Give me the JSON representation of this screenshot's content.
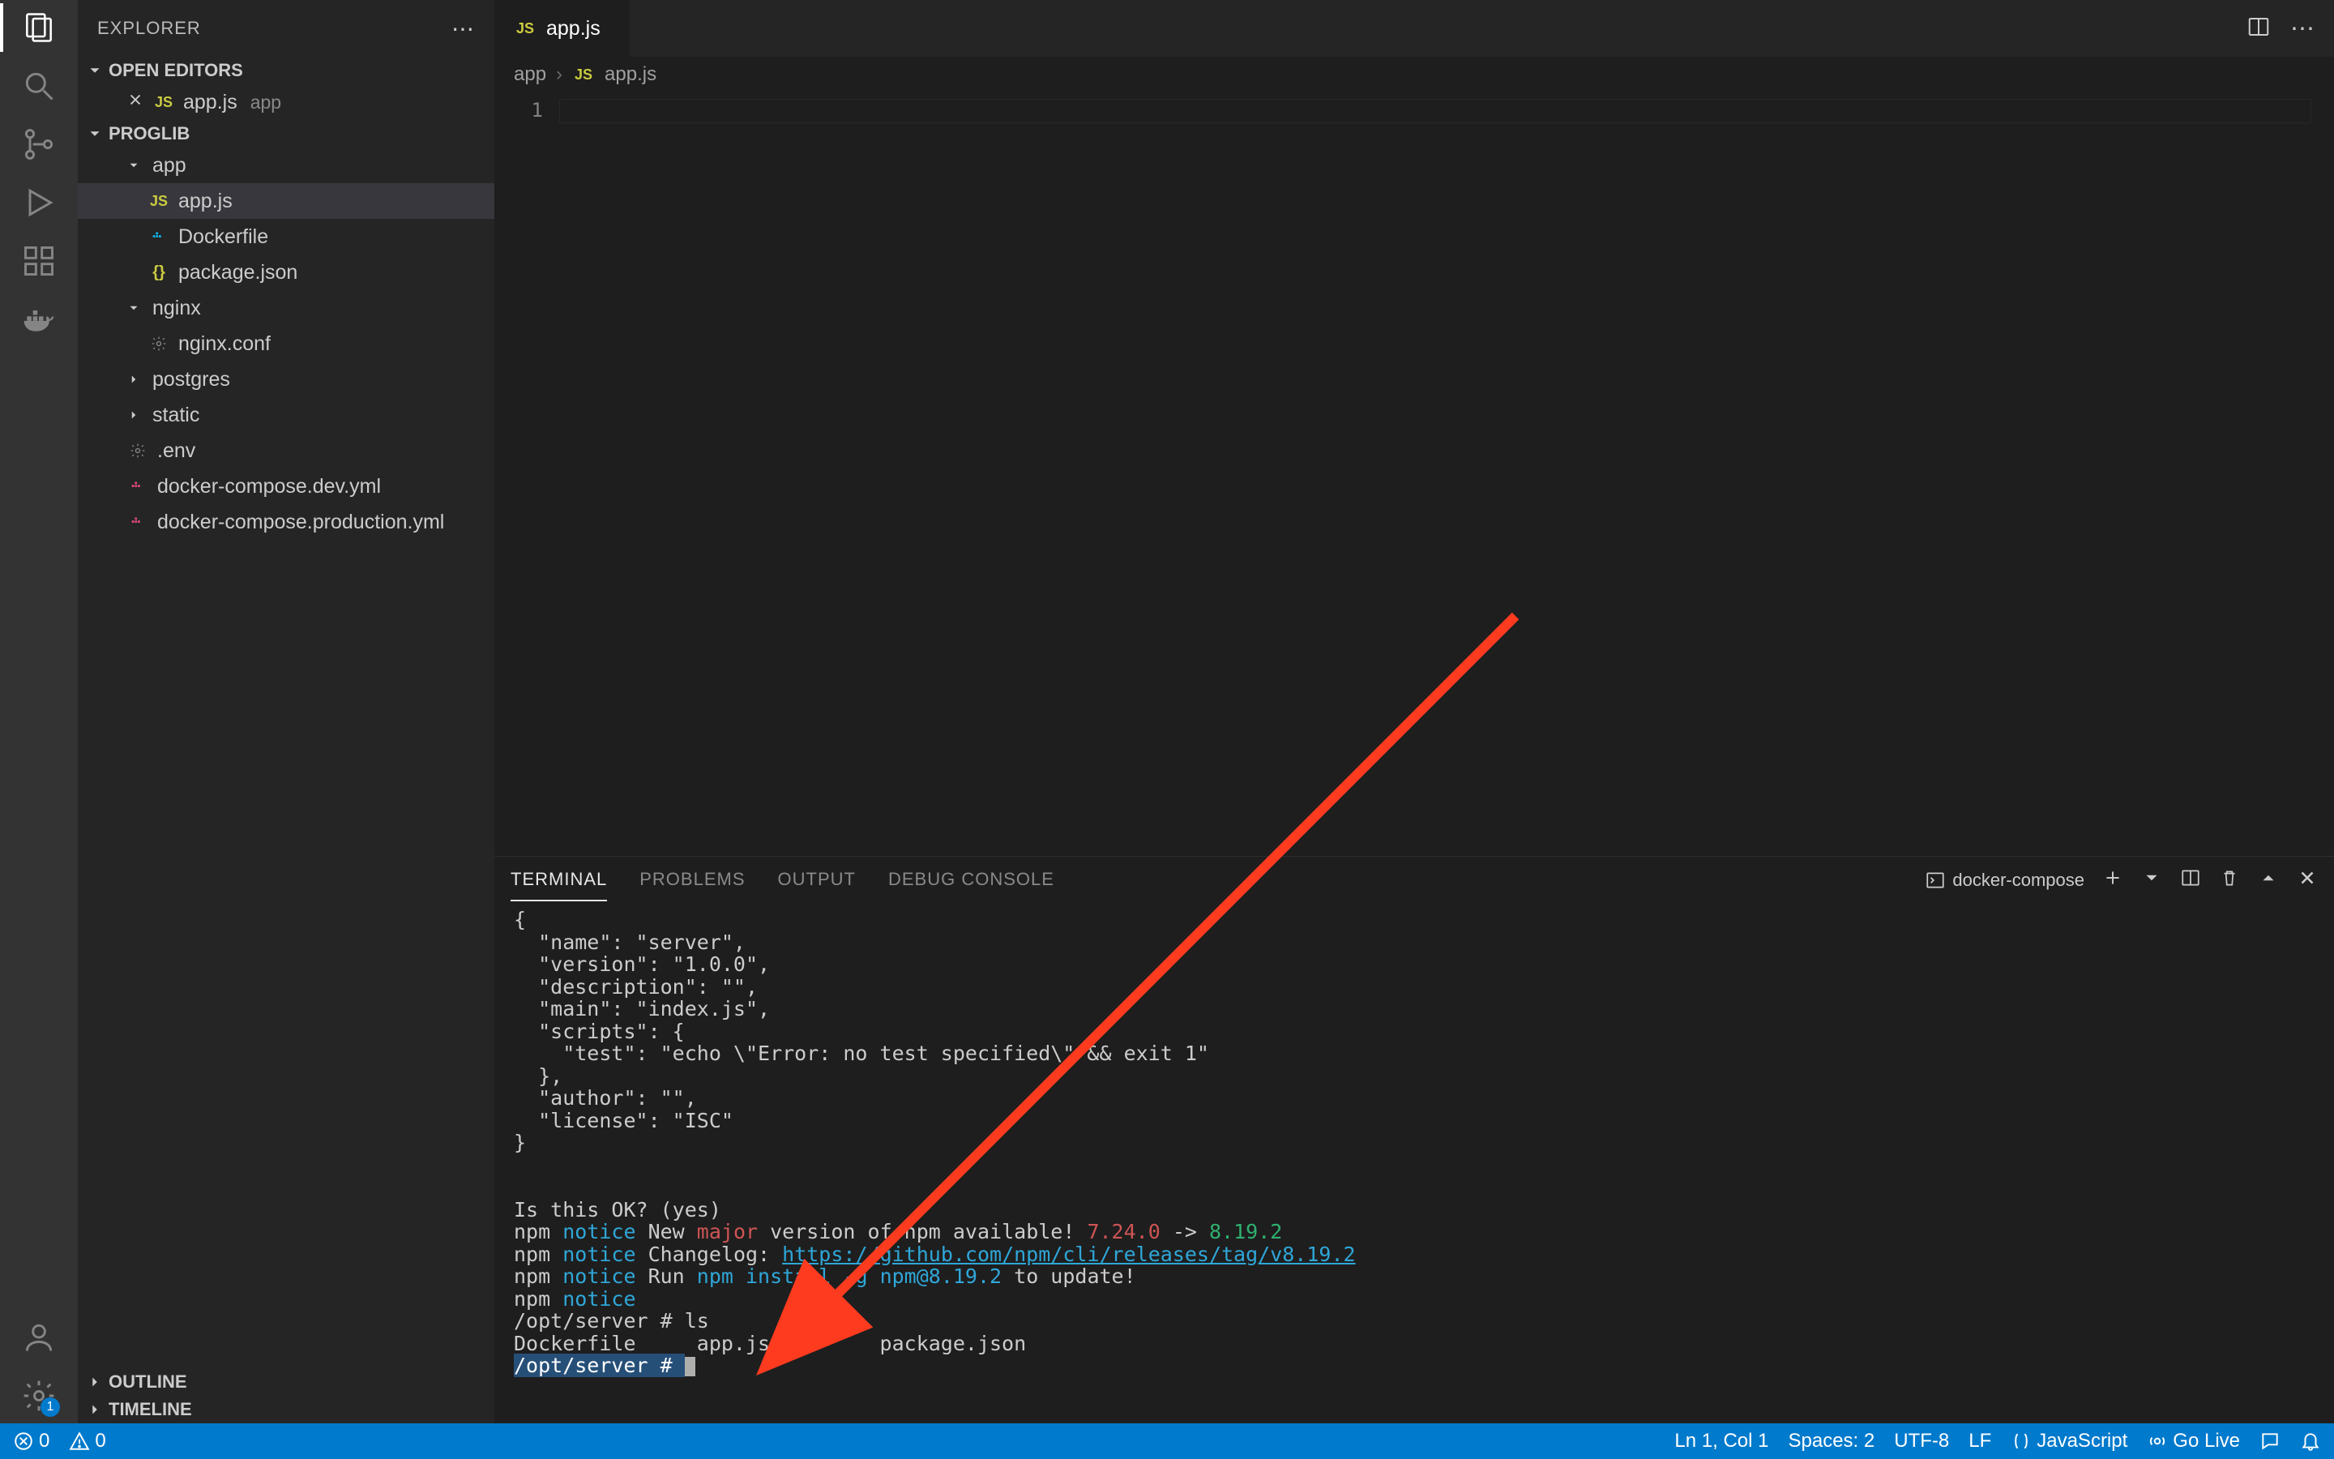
{
  "sidebar": {
    "title": "EXPLORER",
    "open_editors_label": "OPEN EDITORS",
    "project_label": "PROGLIB",
    "open_editors": [
      {
        "name": "app.js",
        "dim": "app",
        "icon": "js"
      }
    ],
    "tree": [
      {
        "type": "folder",
        "name": "app",
        "depth": 1,
        "expanded": true
      },
      {
        "type": "file",
        "name": "app.js",
        "depth": 2,
        "icon": "js",
        "selected": true
      },
      {
        "type": "file",
        "name": "Dockerfile",
        "depth": 2,
        "icon": "docker"
      },
      {
        "type": "file",
        "name": "package.json",
        "depth": 2,
        "icon": "json"
      },
      {
        "type": "folder",
        "name": "nginx",
        "depth": 1,
        "expanded": true
      },
      {
        "type": "file",
        "name": "nginx.conf",
        "depth": 2,
        "icon": "gear"
      },
      {
        "type": "folder",
        "name": "postgres",
        "depth": 1,
        "expanded": false
      },
      {
        "type": "folder",
        "name": "static",
        "depth": 1,
        "expanded": false
      },
      {
        "type": "file",
        "name": ".env",
        "depth": 1,
        "icon": "gear"
      },
      {
        "type": "file",
        "name": "docker-compose.dev.yml",
        "depth": 1,
        "icon": "yaml"
      },
      {
        "type": "file",
        "name": "docker-compose.production.yml",
        "depth": 1,
        "icon": "yaml"
      }
    ],
    "outline_label": "OUTLINE",
    "timeline_label": "TIMELINE"
  },
  "tabs": {
    "items": [
      {
        "name": "app.js",
        "icon": "js"
      }
    ]
  },
  "breadcrumb": {
    "part1": "app",
    "part2": "app.js"
  },
  "editor": {
    "line_numbers": [
      "1"
    ]
  },
  "panel": {
    "tabs": {
      "terminal": "TERMINAL",
      "problems": "PROBLEMS",
      "output": "OUTPUT",
      "debug": "DEBUG CONSOLE"
    },
    "terminal_name": "docker-compose"
  },
  "terminal": {
    "lines": [
      "{",
      "  \"name\": \"server\",",
      "  \"version\": \"1.0.0\",",
      "  \"description\": \"\",",
      "  \"main\": \"index.js\",",
      "  \"scripts\": {",
      "    \"test\": \"echo \\\"Error: no test specified\\\" && exit 1\"",
      "  },",
      "  \"author\": \"\",",
      "  \"license\": \"ISC\"",
      "}",
      "",
      "",
      "Is this OK? (yes)"
    ],
    "notice1_pre": "npm ",
    "notice1_kw": "notice",
    "notice1_new": " New ",
    "notice1_major": "major",
    "notice1_mid": " version of npm available! ",
    "notice1_v1": "7.24.0",
    "notice1_arrow": " -> ",
    "notice1_v2": "8.19.2",
    "notice2_pre": "npm ",
    "notice2_kw": "notice",
    "notice2_txt": " Changelog: ",
    "notice2_link": "https://github.com/npm/cli/releases/tag/v8.19.2",
    "notice3_pre": "npm ",
    "notice3_kw": "notice",
    "notice3_txt": " Run ",
    "notice3_cmd": "npm install -g npm@8.19.2",
    "notice3_end": " to update!",
    "notice4_pre": "npm ",
    "notice4_kw": "notice",
    "prompt1": "/opt/server # ls",
    "ls_out": "Dockerfile     app.js         package.json",
    "prompt2": "/opt/server # "
  },
  "statusbar": {
    "errors": "0",
    "warnings": "0",
    "cursor": "Ln 1, Col 1",
    "spaces": "Spaces: 2",
    "encoding": "UTF-8",
    "eol": "LF",
    "language": "JavaScript",
    "golive": "Go Live"
  },
  "badges": {
    "settings": "1"
  }
}
